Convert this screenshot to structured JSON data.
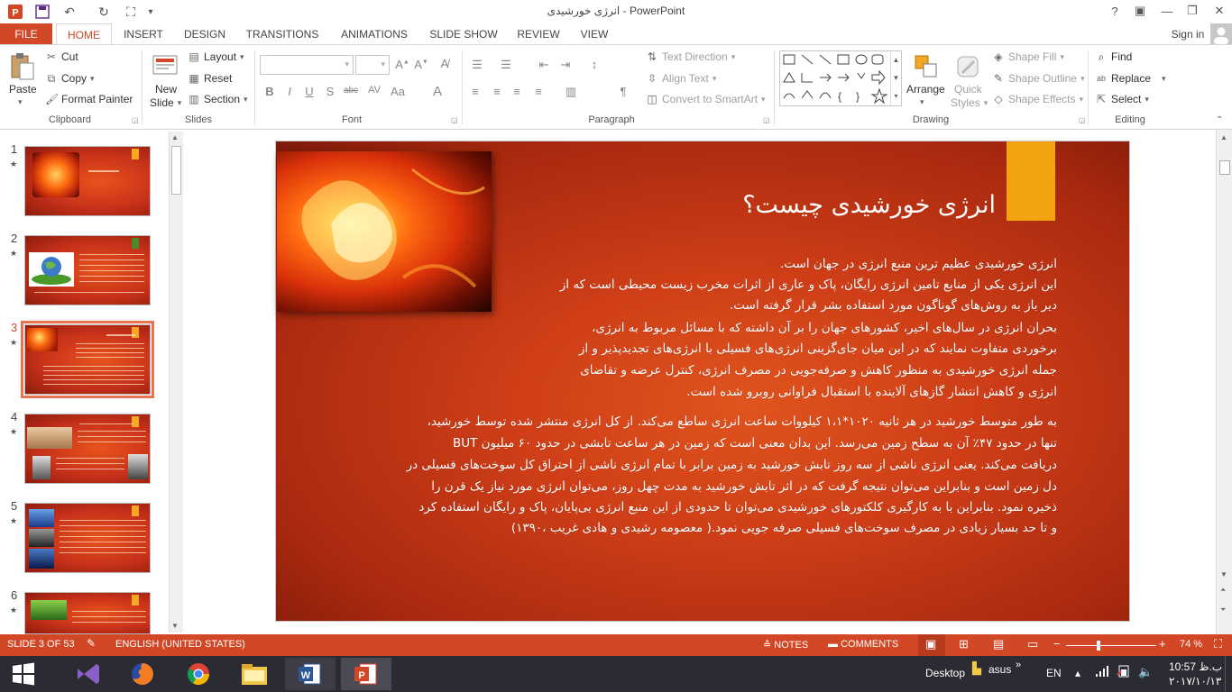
{
  "titlebar": {
    "title": "انرژی خورشیدی - PowerPoint",
    "help": "?",
    "ribbon_display": "▣",
    "minimize": "—",
    "restore": "❐",
    "close": "✕"
  },
  "tabs": {
    "file": "FILE",
    "items": [
      "HOME",
      "INSERT",
      "DESIGN",
      "TRANSITIONS",
      "ANIMATIONS",
      "SLIDE SHOW",
      "REVIEW",
      "VIEW"
    ],
    "active": "HOME",
    "sign_in": "Sign in"
  },
  "ribbon": {
    "clipboard": {
      "paste": "Paste",
      "cut": "Cut",
      "copy": "Copy",
      "format_painter": "Format Painter",
      "label": "Clipboard"
    },
    "slides": {
      "new_slide_1": "New",
      "new_slide_2": "Slide",
      "layout": "Layout",
      "reset": "Reset",
      "section": "Section",
      "label": "Slides"
    },
    "font": {
      "label": "Font",
      "bold": "B",
      "italic": "I",
      "underline": "U",
      "shadow": "S",
      "strike": "abc"
    },
    "paragraph": {
      "label": "Paragraph",
      "text_direction": "Text Direction",
      "align_text": "Align Text",
      "convert_smartart": "Convert to SmartArt"
    },
    "drawing": {
      "label": "Drawing",
      "arrange": "Arrange",
      "quick_styles_1": "Quick",
      "quick_styles_2": "Styles",
      "shape_fill": "Shape Fill",
      "shape_outline": "Shape Outline",
      "shape_effects": "Shape Effects"
    },
    "editing": {
      "label": "Editing",
      "find": "Find",
      "replace": "Replace",
      "select": "Select"
    }
  },
  "thumbnails": [
    {
      "num": "1",
      "star": "★"
    },
    {
      "num": "2",
      "star": "★"
    },
    {
      "num": "3",
      "star": "★"
    },
    {
      "num": "4",
      "star": "★"
    },
    {
      "num": "5",
      "star": "★"
    },
    {
      "num": "6",
      "star": "★"
    }
  ],
  "slide": {
    "title": "انرژی خورشیدی چیست؟",
    "paragraph1": [
      "انرژی خورشیدی عظیم ترین منبع انرژی در جهان است.",
      "این انرژی یکی از منابع تامین انرژی رایگان، پاک و عاری از اثرات مخرب زیست محیطی است که از",
      "دیر باز به روش‌های گوناگون مورد استفاده بشر قرار گرفته است.",
      "بحران انرژی در سال‌های اخیر، کشورهای جهان را بر آن داشته که با مسائل مربوط به انرژی،",
      "برخوردی متفاوت نمایند که در این میان جای‌گزینی انرژی‌های فسیلی با انرژی‌های تجدیدپذیر و از",
      "جمله انرژی خورشیدی به منظور کاهش و صرفه‌جویی در مصرف انرژی، کنترل عرضه و تقاضای",
      "انرژی و کاهش انتشار گازهای آلاینده با استقبال فراوانی روبرو شده است."
    ],
    "paragraph2": [
      "به طور متوسط خورشید در هر ثانیه ۱۰۲۰*۱،۱   کیلووات ساعت انرژی ساطع می‌کند. از کل انرژی منتشر شده توسط خورشید،",
      " تنها در حدود ۴۷٪ آن به سطح زمین می‌رسد. این بدان معنی است که زمین در هر ساعت تابشی در حدود ۶۰ میلیون BUT",
      "دریافت می‌کند. یعنی انرژی ناشی از سه روز تابش خورشید به زمین برابر با تمام انرژی ناشی از احتراق کل سوخت‌های فسیلی در",
      "دل زمین است و بنابراین می‌توان نتیجه گرفت که در اثر تابش خورشید به مدت چهل روز، می‌توان انرژی مورد نیاز یک قرن را",
      "ذخیره نمود. بنابراین با به کارگیری کلکتورهای خورشیدی می‌توان تا حدودی از این منبع انرژی بی‌پایان، پاک و رایگان استفاده کرد",
      "و تا حد بسیار زیادی در مصرف سوخت‌های فسیلی صرفه جویی نمود.( معصومه رشیدی و هادی غریب ،۱۳۹۰)"
    ]
  },
  "status": {
    "slide_of": "SLIDE 3 OF 53",
    "language": "ENGLISH (UNITED STATES)",
    "notes": "NOTES",
    "comments": "COMMENTS",
    "zoom": "74 %",
    "zoom_minus": "−",
    "zoom_plus": "+"
  },
  "taskbar": {
    "desktop": "Desktop",
    "user": "asus",
    "lang": "EN",
    "time": "10:57 ب.ظ",
    "date": "۲۰۱۷/۱۰/۱۳"
  },
  "colors": {
    "accent": "#d24726",
    "slide_gold": "#f2a30f"
  }
}
